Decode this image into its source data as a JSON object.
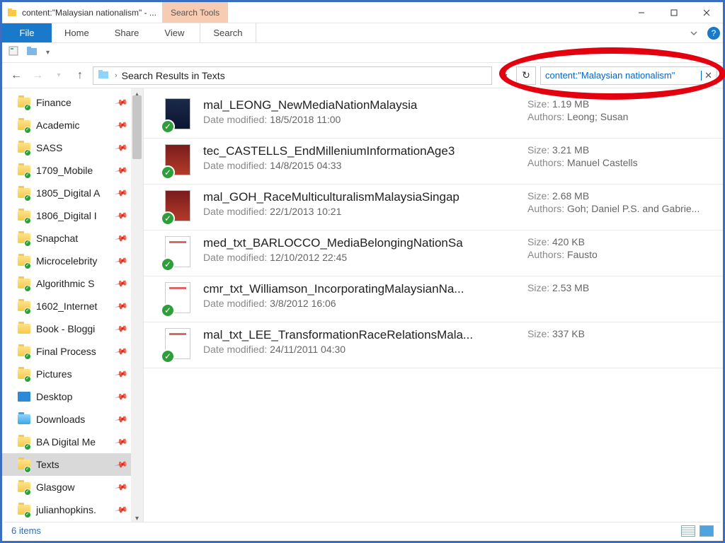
{
  "window": {
    "title": "content:\"Malaysian nationalism\" - ...",
    "search_tools_label": "Search Tools"
  },
  "ribbon": {
    "file": "File",
    "tabs": [
      "Home",
      "Share",
      "View"
    ],
    "search_tab": "Search"
  },
  "address": {
    "breadcrumb_label": "Search Results in Texts",
    "search_value": "content:\"Malaysian nationalism\""
  },
  "sidebar": {
    "items": [
      {
        "label": "Finance",
        "type": "folder",
        "sync": true,
        "pinned": true
      },
      {
        "label": "Academic",
        "type": "folder",
        "sync": true,
        "pinned": true
      },
      {
        "label": "SASS",
        "type": "folder",
        "sync": true,
        "pinned": true
      },
      {
        "label": "1709_Mobile",
        "type": "folder",
        "sync": true,
        "pinned": true
      },
      {
        "label": "1805_Digital A",
        "type": "folder",
        "sync": true,
        "pinned": true
      },
      {
        "label": "1806_Digital I",
        "type": "folder",
        "sync": true,
        "pinned": true
      },
      {
        "label": "Snapchat",
        "type": "folder",
        "sync": true,
        "pinned": true
      },
      {
        "label": "Microcelebrity",
        "type": "folder",
        "sync": true,
        "pinned": true
      },
      {
        "label": "Algorithmic S",
        "type": "folder",
        "sync": true,
        "pinned": true
      },
      {
        "label": "1602_Internet",
        "type": "folder",
        "sync": true,
        "pinned": true
      },
      {
        "label": "Book - Bloggi",
        "type": "folder",
        "sync": false,
        "pinned": true
      },
      {
        "label": "Final Process",
        "type": "folder",
        "sync": true,
        "pinned": true
      },
      {
        "label": "Pictures",
        "type": "folder",
        "sync": true,
        "pinned": true
      },
      {
        "label": "Desktop",
        "type": "desktop",
        "sync": false,
        "pinned": true
      },
      {
        "label": "Downloads",
        "type": "folder-blue",
        "sync": false,
        "pinned": true
      },
      {
        "label": "BA Digital Me",
        "type": "folder",
        "sync": true,
        "pinned": true
      },
      {
        "label": "Texts",
        "type": "folder",
        "sync": true,
        "pinned": true,
        "selected": true
      },
      {
        "label": "Glasgow",
        "type": "folder",
        "sync": true,
        "pinned": true
      },
      {
        "label": "julianhopkins.",
        "type": "folder",
        "sync": true,
        "pinned": true
      }
    ]
  },
  "labels": {
    "date_modified": "Date modified:",
    "size": "Size:",
    "authors": "Authors:"
  },
  "results": [
    {
      "name": "mal_LEONG_NewMediaNationMalaysia",
      "date": "18/5/2018 11:00",
      "size": "1.19 MB",
      "authors": "Leong; Susan",
      "thumb": "bw"
    },
    {
      "name": "tec_CASTELLS_EndMilleniumInformationAge3",
      "date": "14/8/2015 04:33",
      "size": "3.21 MB",
      "authors": "Manuel Castells",
      "thumb": "red"
    },
    {
      "name": "mal_GOH_RaceMulticulturalismMalaysiaSingap",
      "date": "22/1/2013 10:21",
      "size": "2.68 MB",
      "authors": "Goh; Daniel P.S. and Gabrie...",
      "thumb": "red"
    },
    {
      "name": "med_txt_BARLOCCO_MediaBelongingNationSa",
      "date": "12/10/2012 22:45",
      "size": "420 KB",
      "authors": "Fausto",
      "thumb": "doc"
    },
    {
      "name": "cmr_txt_Williamson_IncorporatingMalaysianNa...",
      "date": "3/8/2012 16:06",
      "size": "2.53 MB",
      "authors": "",
      "thumb": "doc"
    },
    {
      "name": "mal_txt_LEE_TransformationRaceRelationsMala...",
      "date": "24/11/2011 04:30",
      "size": "337 KB",
      "authors": "",
      "thumb": "doc"
    }
  ],
  "status": {
    "count_label": "6 items"
  }
}
